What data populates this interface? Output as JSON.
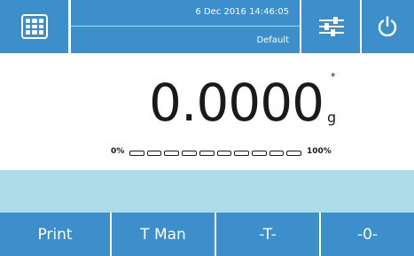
{
  "header": {
    "datetime": "6 Dec 2016 14:46:05",
    "profile": "Default",
    "menu_icon": "grid-menu-icon",
    "settings_icon": "sliders-icon",
    "power_icon": "power-icon"
  },
  "display": {
    "weight": "0.0000",
    "stability_mark": "*",
    "unit": "g",
    "capacity_min_label": "0%",
    "capacity_max_label": "100%",
    "capacity_used_fraction": 0,
    "capacity_segments": 10
  },
  "info_strip": {},
  "actions": {
    "print": "Print",
    "tare_manual": "T Man",
    "tare": "-T-",
    "zero": "-0-"
  },
  "colors": {
    "bar_blue": "#3d8fcc",
    "info_strip": "#acdce8"
  }
}
